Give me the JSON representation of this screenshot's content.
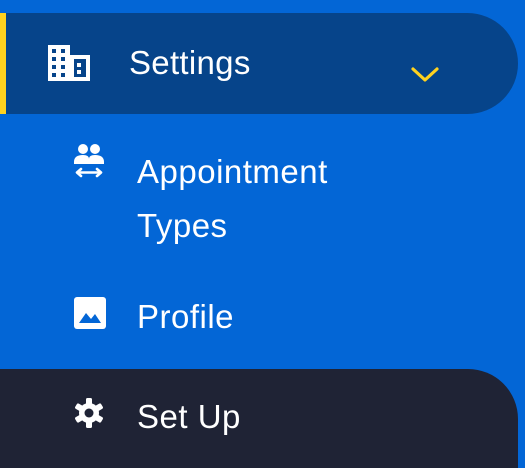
{
  "colors": {
    "background": "#0366d6",
    "active_row": "#06448a",
    "active_indicator": "#ffd21f",
    "setup_row": "#1f2335",
    "text": "#ffffff",
    "chevron": "#ffd21f"
  },
  "sidebar": {
    "settings": {
      "label": "Settings",
      "icon": "building-icon",
      "expanded": true,
      "chevron_icon": "chevron-down-icon"
    },
    "children": [
      {
        "label": "Appointment Types",
        "icon": "people-swap-icon"
      },
      {
        "label": "Profile",
        "icon": "image-icon"
      }
    ],
    "setup": {
      "label": "Set Up",
      "icon": "gear-icon"
    }
  }
}
